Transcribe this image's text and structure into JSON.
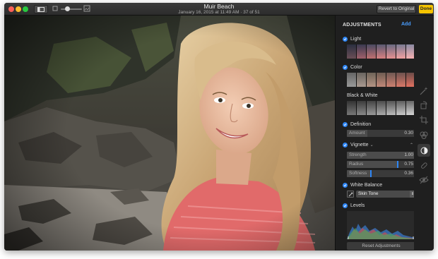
{
  "window": {
    "title": "Muir Beach",
    "subtitle": "January 16, 2015 at 11:49 AM  ·  37 of 51"
  },
  "toolbar": {
    "revert_label": "Revert to Original",
    "done_label": "Done"
  },
  "panel": {
    "header": "ADJUSTMENTS",
    "add_label": "Add",
    "sections": {
      "light": {
        "title": "Light",
        "enabled": true
      },
      "color": {
        "title": "Color",
        "enabled": true
      },
      "bw": {
        "title": "Black & White",
        "enabled": false
      },
      "definition": {
        "title": "Definition",
        "enabled": true,
        "amount": {
          "label": "Amount",
          "value": "0.30",
          "fraction": 0.3
        }
      },
      "vignette": {
        "title": "Vignette",
        "enabled": true,
        "strength": {
          "label": "Strength",
          "value": "1.00",
          "fraction": 1.0
        },
        "radius": {
          "label": "Radius",
          "value": "0.75",
          "fraction": 0.75
        },
        "softness": {
          "label": "Softness",
          "value": "0.36",
          "fraction": 0.36
        }
      },
      "white_balance": {
        "title": "White Balance",
        "enabled": true,
        "mode": "Skin Tone"
      },
      "levels": {
        "title": "Levels",
        "enabled": true
      }
    },
    "reset_label": "Reset Adjustments"
  },
  "colors": {
    "accent": "#2e86f5",
    "done": "#f5c400",
    "add": "#4a9eff"
  },
  "icons": {
    "sidebar_toggle": "sidebar-icon",
    "zoom_small": "image-small-icon",
    "zoom_large": "image-large-icon",
    "strip": [
      "enhance-icon",
      "rotate-icon",
      "crop-icon",
      "filters-icon",
      "adjust-icon",
      "retouch-icon",
      "red-eye-icon"
    ]
  }
}
